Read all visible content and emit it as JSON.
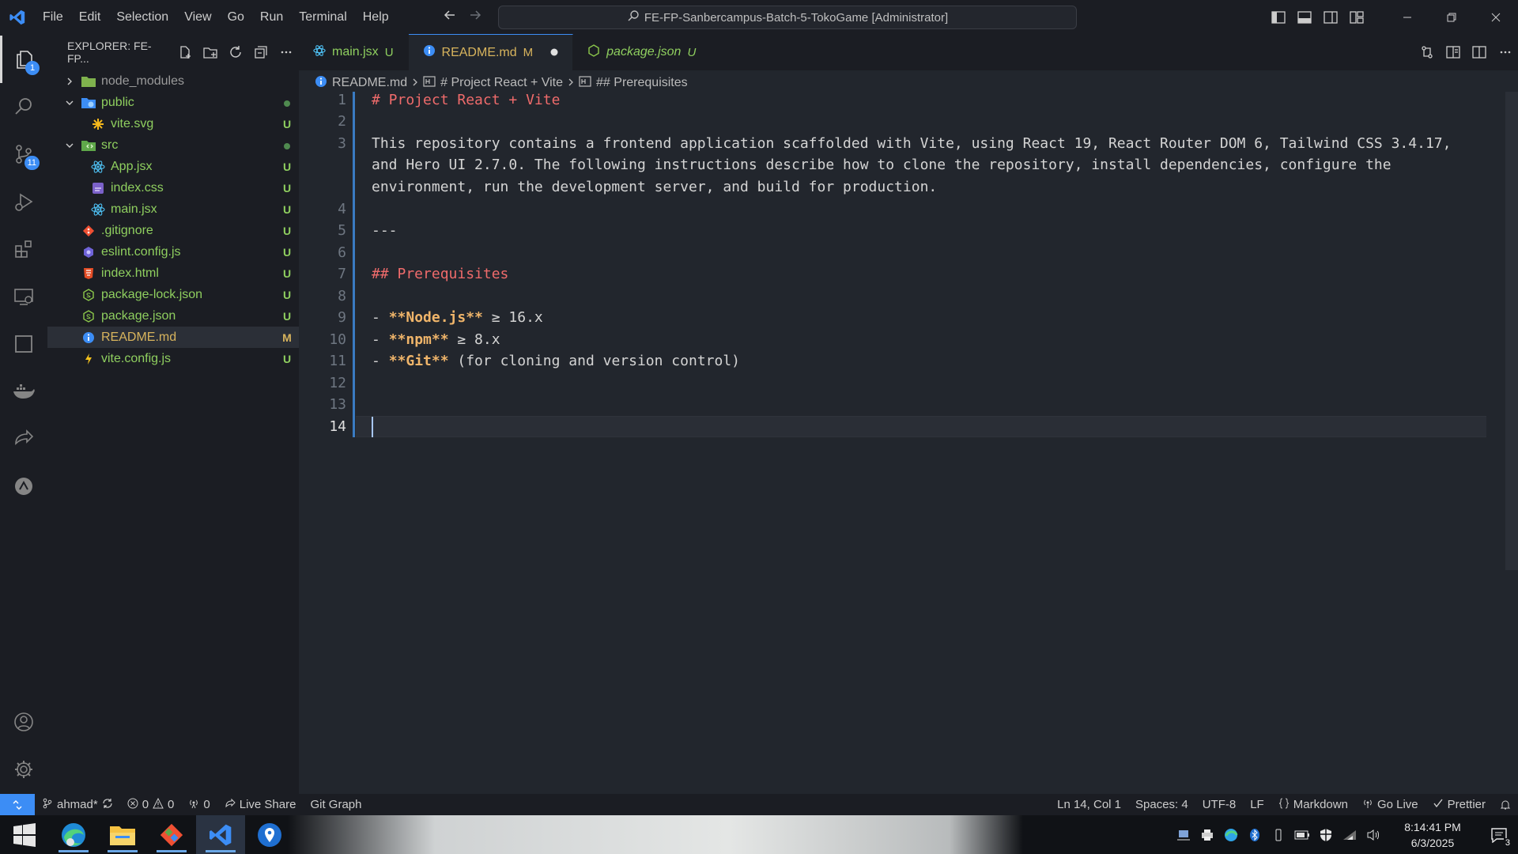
{
  "menu": [
    "File",
    "Edit",
    "Selection",
    "View",
    "Go",
    "Run",
    "Terminal",
    "Help"
  ],
  "command_center": "FE-FP-Sanbercampus-Batch-5-TokoGame [Administrator]",
  "activity": {
    "explorer_badge": "1",
    "scm_badge": "11"
  },
  "explorer": {
    "title": "EXPLORER: FE-FP...",
    "items": [
      {
        "name": "node_modules",
        "status": ""
      },
      {
        "name": "public",
        "status": ""
      },
      {
        "name": "vite.svg",
        "status": "U"
      },
      {
        "name": "src",
        "status": ""
      },
      {
        "name": "App.jsx",
        "status": "U"
      },
      {
        "name": "index.css",
        "status": "U"
      },
      {
        "name": "main.jsx",
        "status": "U"
      },
      {
        "name": ".gitignore",
        "status": "U"
      },
      {
        "name": "eslint.config.js",
        "status": "U"
      },
      {
        "name": "index.html",
        "status": "U"
      },
      {
        "name": "package-lock.json",
        "status": "U"
      },
      {
        "name": "package.json",
        "status": "U"
      },
      {
        "name": "README.md",
        "status": "M"
      },
      {
        "name": "vite.config.js",
        "status": "U"
      }
    ]
  },
  "tabs": [
    {
      "label": "main.jsx",
      "status": "U"
    },
    {
      "label": "README.md",
      "status": "M"
    },
    {
      "label": "package.json",
      "status": "U"
    }
  ],
  "breadcrumb": [
    "README.md",
    "# Project React + Vite",
    "## Prerequisites"
  ],
  "code": {
    "line_numbers": [
      "1",
      "2",
      "3",
      "4",
      "5",
      "6",
      "7",
      "8",
      "9",
      "10",
      "11",
      "12",
      "13",
      "14"
    ],
    "l1": "# Project React + Vite",
    "l3a": "This repository contains a frontend application scaffolded with Vite, using React 19, React Router DOM 6, Tailwind CSS 3.4.17,",
    "l3b": "and Hero UI 2.7.0. The following instructions describe how to clone the repository, install dependencies, configure the",
    "l3c": "environment, run the development server, and build for production.",
    "l5": "---",
    "l7": "## Prerequisites",
    "l9_dash": "- ",
    "l9_bold": "**Node.js**",
    "l9_rest": " ≥ 16.x",
    "l10_dash": "- ",
    "l10_bold": "**npm**",
    "l10_rest": " ≥ 8.x",
    "l11_dash": "- ",
    "l11_bold": "**Git**",
    "l11_rest": " (for cloning and version control)"
  },
  "status": {
    "branch": "ahmad*",
    "errors": "0",
    "warnings": "0",
    "ports": "0",
    "live_share": "Live Share",
    "git_graph": "Git Graph",
    "position": "Ln 14, Col 1",
    "spaces": "Spaces: 4",
    "encoding": "UTF-8",
    "eol": "LF",
    "language": "Markdown",
    "go_live": "Go Live",
    "prettier": "Prettier"
  },
  "taskbar": {
    "time": "8:14:41 PM",
    "date": "6/3/2025",
    "notifications": "3"
  },
  "colors": {
    "accent": "#3c8df5",
    "heading": "#ef6b6b",
    "bold": "#f0b56a",
    "untracked": "#8fcf5f",
    "modified": "#d8b45d"
  }
}
